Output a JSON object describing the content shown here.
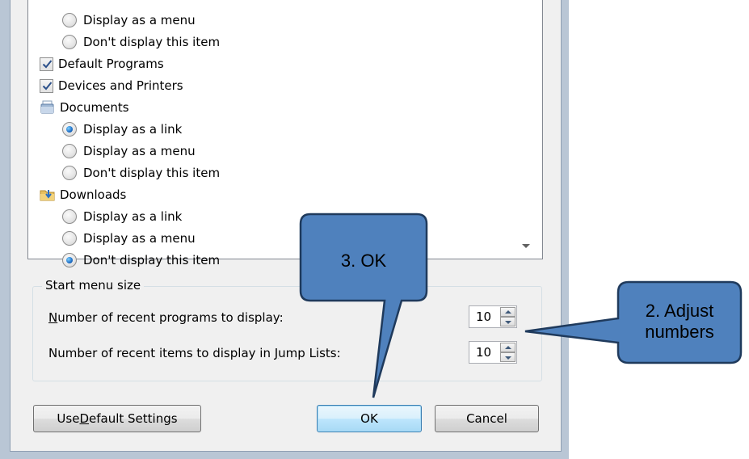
{
  "list_items": [
    {
      "kind": "radio",
      "label": "Display as a menu",
      "checked": false
    },
    {
      "kind": "radio",
      "label": "Don't display this item",
      "checked": false
    },
    {
      "kind": "checkbox",
      "label": "Default Programs",
      "checked": true
    },
    {
      "kind": "checkbox",
      "label": "Devices and Printers",
      "checked": true
    },
    {
      "kind": "header",
      "label": "Documents",
      "icon": "documents-icon"
    },
    {
      "kind": "radio",
      "label": "Display as a link",
      "checked": true
    },
    {
      "kind": "radio",
      "label": "Display as a menu",
      "checked": false
    },
    {
      "kind": "radio",
      "label": "Don't display this item",
      "checked": false
    },
    {
      "kind": "header",
      "label": "Downloads",
      "icon": "downloads-folder-icon"
    },
    {
      "kind": "radio",
      "label": "Display as a link",
      "checked": false
    },
    {
      "kind": "radio",
      "label": "Display as a menu",
      "checked": false
    },
    {
      "kind": "radio",
      "label": "Don't display this item",
      "checked": true
    }
  ],
  "start_menu_size": {
    "legend": "Start menu size",
    "recent_programs": {
      "label_underline": "N",
      "label_rest": "umber of recent programs to display:",
      "value": "10"
    },
    "recent_items": {
      "label_before": "Number of recent items to display in ",
      "label_underline": "J",
      "label_after": "ump Lists:",
      "value": "10"
    }
  },
  "buttons": {
    "use_default": {
      "before": "Use ",
      "underline": "D",
      "after": "efault Settings"
    },
    "ok": "OK",
    "cancel": "Cancel"
  },
  "callouts": {
    "ok": "3. OK",
    "adjust_line1": "2. Adjust",
    "adjust_line2": "numbers"
  },
  "colors": {
    "callout_fill": "#4f81bd",
    "callout_stroke": "#1f3a5c"
  }
}
